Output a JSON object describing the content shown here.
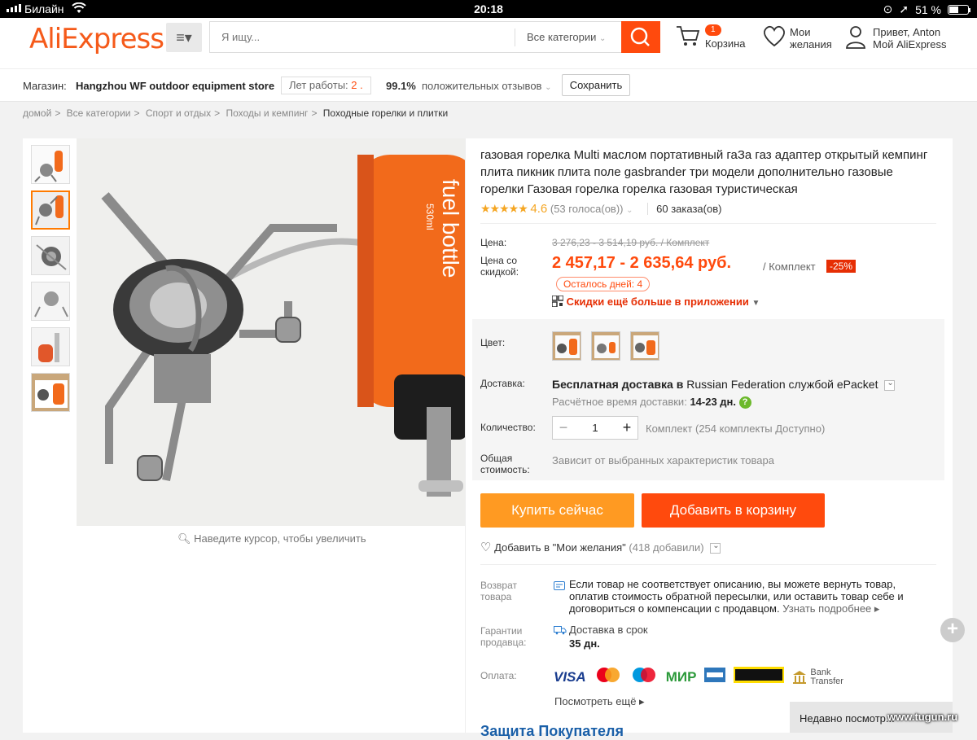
{
  "statusbar": {
    "carrier": "Билайн",
    "time": "20:18",
    "battery": "51 %",
    "battery_level": 0.51
  },
  "header": {
    "logo": "AliExpress",
    "search_placeholder": "Я ищу...",
    "categories": "Все категории",
    "cart_count": "1",
    "cart_label": "Корзина",
    "wishlist_l1": "Мои",
    "wishlist_l2": "желания",
    "account_l1": "Привет, Anton",
    "account_l2": "Мой AliExpress"
  },
  "store": {
    "label": "Магазин:",
    "name": "Hangzhou WF outdoor equipment store",
    "years_label": "Лет работы:",
    "years_value": "2 .",
    "positive_pct": "99.1%",
    "positive_label": "положительных отзывов",
    "save_button": "Сохранить"
  },
  "breadcrumb": [
    "домой",
    "Все категории",
    "Спорт и отдых",
    "Походы и кемпинг",
    "Походные горелки и плитки"
  ],
  "product": {
    "title": "газовая горелка Multi маслом портативный гаЗа газ адаптер открытый кемпинг плита пикник плита поле gasbrander три модели дополнительно газовые горелки Газовая горелка горелка газовая туристическая",
    "rating": "4.6",
    "rating_value": 4.6,
    "votes": "(53 голоса(ов))",
    "orders": "60 заказа(ов)",
    "price_label": "Цена:",
    "old_price": "3 276,23 - 3 514,19 руб. / Комплект",
    "discount_label": "Цена со скидкой:",
    "new_price": "2 457,17 - 2 635,64 руб.",
    "unit": "/ Комплект",
    "discount_badge": "-25%",
    "days_left": "Осталось дней: 4",
    "app_promo": "Скидки ещё больше в приложении",
    "color_label": "Цвет:",
    "shipping_label": "Доставка:",
    "shipping_bold": "Бесплатная доставка в",
    "shipping_rest": "Russian Federation службой ePacket",
    "shipping_time_label": "Расчётное время доставки:",
    "shipping_time": "14-23 дн.",
    "qty_label": "Количество:",
    "qty_value": "1",
    "qty_available": "Комплект (254 комплекты Доступно)",
    "total_label": "Общая стоимость:",
    "total_value": "Зависит от выбранных характеристик товара",
    "buy_now": "Купить сейчас",
    "add_to_cart": "Добавить в корзину",
    "wishlist_add": "Добавить в \"Мои желания\"",
    "wishlist_count": "(418 добавили)",
    "zoom_hint": "Наведите курсор, чтобы увеличить",
    "bottle_text1": "fuel bottle",
    "bottle_text2": "530ml"
  },
  "guarantees": {
    "return_label": "Возврат товара",
    "return_text": "Если товар не соответствует описанию, вы можете вернуть товар, оплатив стоимость обратной пересылки, или оставить товар себе и договориться о компенсации с продавцом.",
    "return_more": "Узнать подробнее",
    "seller_label": "Гарантии продавца:",
    "delivery_on_time": "Доставка в срок",
    "delivery_days": "35 дн.",
    "payment_label": "Оплата:",
    "payments": [
      "VISA",
      "MasterCard",
      "Maestro",
      "МИР",
      "AMEX",
      "WESTERN UNION",
      "Bank Transfer"
    ],
    "see_more": "Посмотреть ещё",
    "bottom_heading": "Защита Покупателя"
  },
  "recently_viewed": "Недавно посмотр...",
  "watermark": "www.tugun.ru",
  "colors": {
    "accent": "#ff4a0d",
    "buy": "#ff9a22",
    "star": "#f5a623"
  }
}
